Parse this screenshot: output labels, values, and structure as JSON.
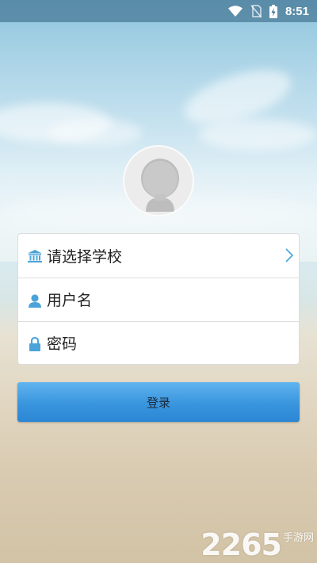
{
  "status_bar": {
    "time": "8:51",
    "icons": [
      "wifi-icon",
      "no-sim-icon",
      "battery-charging-icon"
    ]
  },
  "avatar": {
    "icon": "default-avatar-icon"
  },
  "form": {
    "school": {
      "label": "请选择学校",
      "icon": "school-icon"
    },
    "username": {
      "placeholder": "用户名",
      "value": "",
      "icon": "user-icon"
    },
    "password": {
      "placeholder": "密码",
      "value": "",
      "icon": "lock-icon"
    }
  },
  "login_button": {
    "label": "登录"
  },
  "watermark": {
    "number": "2265",
    "text": "手游网"
  },
  "colors": {
    "accent": "#3a95de",
    "icon_blue": "#4aa3d9"
  }
}
